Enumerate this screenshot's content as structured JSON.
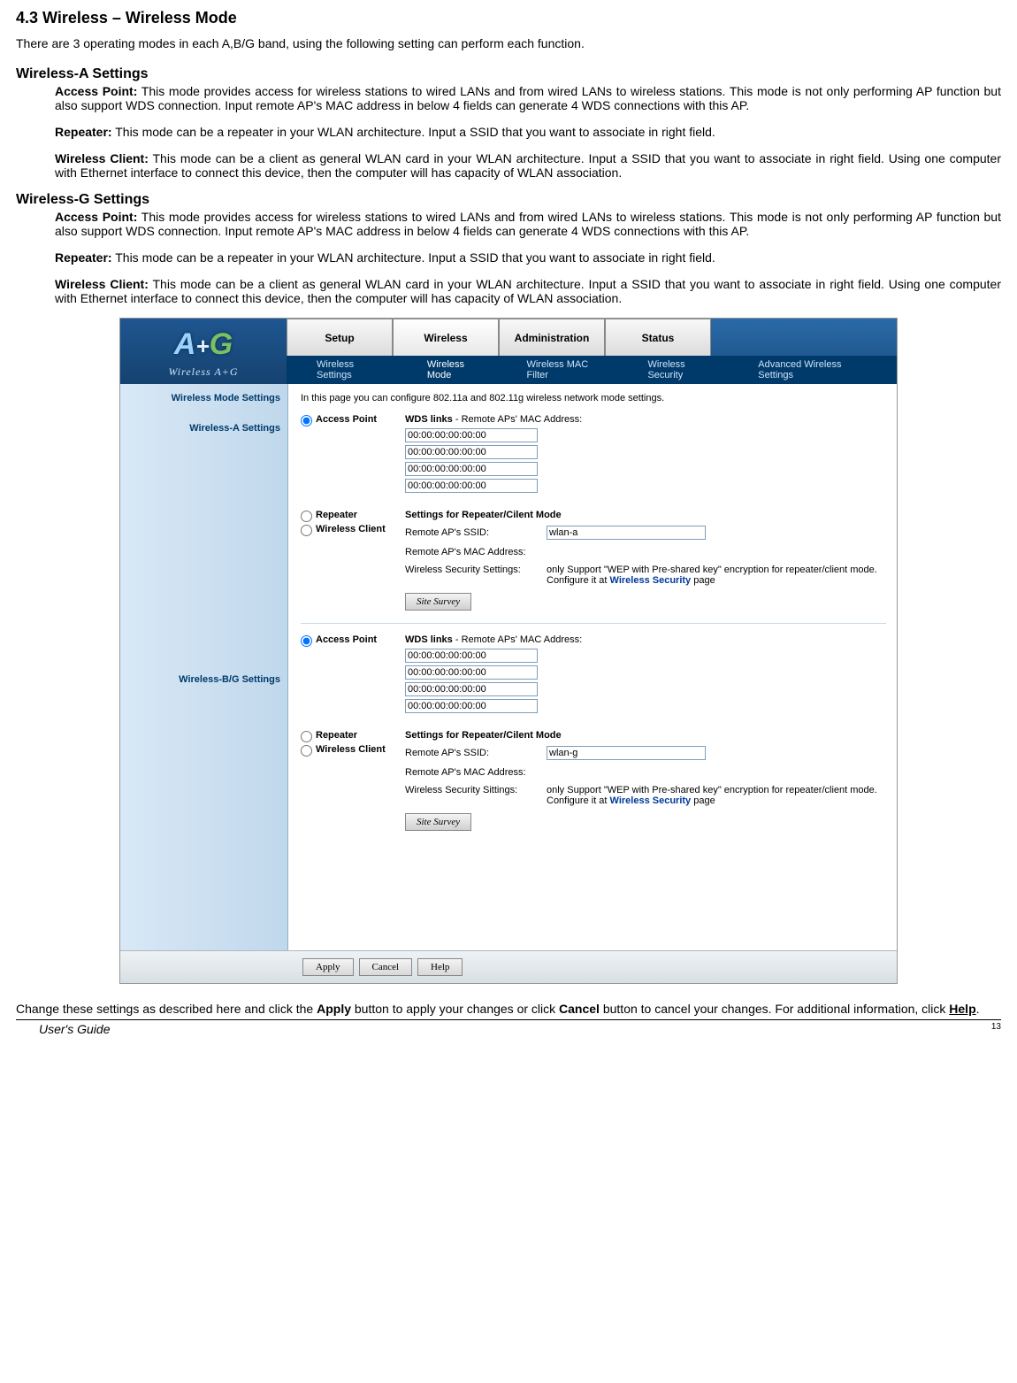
{
  "doc": {
    "section_title": "4.3 Wireless – Wireless Mode",
    "intro": "There are 3 operating modes in each A,B/G band, using the following setting can perform each function.",
    "wa_title": "Wireless-A Settings",
    "wg_title": "Wireless-G Settings",
    "ap_label": "Access Point:",
    "ap_text": " This mode provides access for wireless stations to wired LANs and from wired LANs to wireless stations. This mode is not only performing AP function but also support WDS connection. Input remote AP's MAC address in below 4 fields can generate 4 WDS connections with this AP.",
    "rep_label": "Repeater:",
    "rep_text": " This mode can be a repeater in your WLAN architecture. Input a SSID that you want to associate in right field.",
    "wc_label": "Wireless Client:",
    "wc_text": " This mode can be a client as general WLAN card in your WLAN architecture. Input a SSID that you want to associate in right field. Using one computer with Ethernet interface to connect this device, then the computer will has capacity of WLAN association.",
    "footer_pre": "Change these settings as described here and click the ",
    "footer_apply": "Apply",
    "footer_mid": " button to apply your changes or click ",
    "footer_cancel": "Cancel",
    "footer_mid2": " button to cancel your changes. For additional information, click ",
    "footer_help": "Help",
    "footer_dot": ".",
    "guide": "User's Guide",
    "pagenum": "13"
  },
  "ui": {
    "logo_text": "Wireless A+G",
    "tabs": [
      "Setup",
      "Wireless",
      "Administration",
      "Status"
    ],
    "subtabs": [
      "Wireless Settings",
      "Wireless Mode",
      "Wireless MAC Filter",
      "Wireless Security",
      "Advanced Wireless Settings"
    ],
    "sidebar": {
      "mode_settings": "Wireless Mode Settings",
      "wa": "Wireless-A Settings",
      "wbg": "Wireless-B/G Settings"
    },
    "intro": "In this page you can configure 802.11a and 802.11g wireless network mode settings.",
    "radios": {
      "ap": "Access Point",
      "rep": "Repeater",
      "wc": "Wireless Client"
    },
    "wds_title": "WDS links",
    "wds_sub": " - Remote APs' MAC Address:",
    "mac_default": "00:00:00:00:00:00",
    "rep_hdr": "Settings for Repeater/Cilent Mode",
    "rep_ssid_lbl": "Remote AP's SSID:",
    "rep_mac_lbl": "Remote AP's MAC Address:",
    "rep_sec_lbl": "Wireless Security Settings:",
    "rep_sec_lbl2": "Wireless Security Sittings:",
    "rep_sec_note": "only Support \"WEP with Pre-shared key\" encryption for repeater/client mode.",
    "rep_sec_note2": "Configure it at ",
    "rep_sec_link": "Wireless Security",
    "rep_sec_note3": " page",
    "ssid_a": "wlan-a",
    "ssid_g": "wlan-g",
    "site_survey": "Site Survey",
    "btn_apply": "Apply",
    "btn_cancel": "Cancel",
    "btn_help": "Help"
  }
}
